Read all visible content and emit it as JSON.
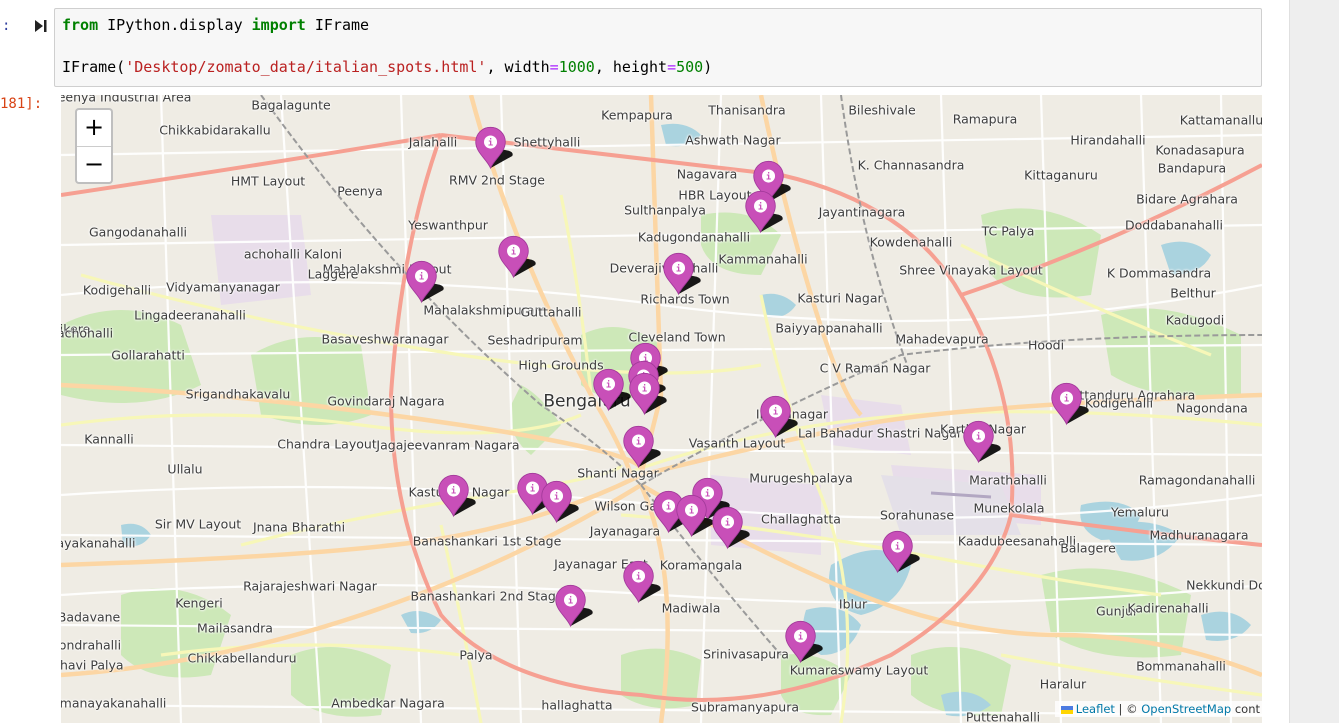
{
  "input_cell": {
    "prompt": ":",
    "line1": {
      "kw1": "from",
      "mod": " IPython.display ",
      "kw2": "import",
      "name": " IFrame"
    },
    "line2": {
      "func": "IFrame(",
      "path": "'Desktop/zomato_data/italian_spots.html'",
      "sep1": ", width",
      "eq1": "=",
      "w": "1000",
      "sep2": ", height",
      "eq2": "=",
      "h": "500",
      "close": ")"
    }
  },
  "output_cell": {
    "prompt": "181]:"
  },
  "map": {
    "zoom_in": "+",
    "zoom_out": "−",
    "attribution": {
      "leaflet": "Leaflet",
      "sep": " | © ",
      "osm": "OpenStreetMap",
      "tail": " cont"
    },
    "places": [
      {
        "name": "Bagalagunte"
      },
      {
        "name": "Chikkabidarakallu"
      },
      {
        "name": "Jalahalli"
      },
      {
        "name": "Shettyhalli"
      },
      {
        "name": "RMV 2nd Stage"
      },
      {
        "name": "Thanisandra"
      },
      {
        "name": "Kempapura"
      },
      {
        "name": "Bileshivale"
      },
      {
        "name": "Ramapura"
      },
      {
        "name": "Hirandahalli"
      },
      {
        "name": "Kattamanallur"
      },
      {
        "name": "Konadasapura"
      },
      {
        "name": "Ashwath Nagar"
      },
      {
        "name": "K. Channasandra"
      },
      {
        "name": "Bandapura"
      },
      {
        "name": "Nagavara"
      },
      {
        "name": "Kittaganuru"
      },
      {
        "name": "HMT Layout"
      },
      {
        "name": "Peenya"
      },
      {
        "name": "HBR Layout"
      },
      {
        "name": "Jayantinagara"
      },
      {
        "name": "Bidare Agrahara"
      },
      {
        "name": "Sulthanpalya"
      },
      {
        "name": "Yeswanthpur"
      },
      {
        "name": "Doddabanahalli"
      },
      {
        "name": "Gangodanahalli"
      },
      {
        "name": "Kadugondanahalli"
      },
      {
        "name": "Kowdenahalli"
      },
      {
        "name": "TC Palya"
      },
      {
        "name": "Mahalakshmi Layout"
      },
      {
        "name": "Laggere"
      },
      {
        "name": "Deverajivanahalli"
      },
      {
        "name": "Kammanahalli"
      },
      {
        "name": "Shree Vinayaka Layout"
      },
      {
        "name": "Vidyamanyanagar"
      },
      {
        "name": "K Dommasandra"
      },
      {
        "name": "Richards Town"
      },
      {
        "name": "Kasturi Nagar"
      },
      {
        "name": "Belthur"
      },
      {
        "name": "Kodigehalli"
      },
      {
        "name": "Lingadeeranahalli"
      },
      {
        "name": "Mahalakshmipuram"
      },
      {
        "name": "Guttahalli"
      },
      {
        "name": "Kadugodi"
      },
      {
        "name": "Baiyyappanahalli"
      },
      {
        "name": "Basaveshwaranagar"
      },
      {
        "name": "Seshadripuram"
      },
      {
        "name": "Cleveland Town"
      },
      {
        "name": "Mahadevapura"
      },
      {
        "name": "Hoodi"
      },
      {
        "name": "Gollarahatti"
      },
      {
        "name": "C V Raman Nagar"
      },
      {
        "name": "High Grounds"
      },
      {
        "name": "Srigandhakavalu"
      },
      {
        "name": "Govindaraj Nagara"
      },
      {
        "name": "Pattanduru Agrahara"
      },
      {
        "name": "Kodigehalli"
      },
      {
        "name": "Bengaluru"
      },
      {
        "name": "Nagondana"
      },
      {
        "name": "Indiranagar"
      },
      {
        "name": "Lal Bahadur Shastri Nagar"
      },
      {
        "name": "Karthik Nagar"
      },
      {
        "name": "Kannalli"
      },
      {
        "name": "Chandra Layout"
      },
      {
        "name": "Jagajeevanram Nagara"
      },
      {
        "name": "Vasanth Layout"
      },
      {
        "name": "Ullalu"
      },
      {
        "name": "Shanti Nagar"
      },
      {
        "name": "Murugeshpalaya"
      },
      {
        "name": "Marathahalli"
      },
      {
        "name": "Ramagondanahalli"
      },
      {
        "name": "Kasturiba Nagar"
      },
      {
        "name": "Munekolala"
      },
      {
        "name": "Wilson Garden"
      },
      {
        "name": "Yemaluru"
      },
      {
        "name": "Sorahunase"
      },
      {
        "name": "Sir MV Layout"
      },
      {
        "name": "Jnana Bharathi"
      },
      {
        "name": "Banashankari 1st Stage"
      },
      {
        "name": "Challaghatta"
      },
      {
        "name": "Madhuranagara"
      },
      {
        "name": "Jayanagara"
      },
      {
        "name": "Kaadubeesanahalli"
      },
      {
        "name": "Balagere"
      },
      {
        "name": "Jayanagar East"
      },
      {
        "name": "Koramangala"
      },
      {
        "name": "Rajarajeshwari Nagar"
      },
      {
        "name": "Banashankari 2nd Stage"
      },
      {
        "name": "Kengeri"
      },
      {
        "name": "Nekkundi Do"
      },
      {
        "name": "Madiwala"
      },
      {
        "name": "Iblur"
      },
      {
        "name": "Gunjur"
      },
      {
        "name": "Badavane"
      },
      {
        "name": "Mailasandra"
      },
      {
        "name": "Kadirenahalli"
      },
      {
        "name": "Kaikondrahalli"
      },
      {
        "name": "Chikkabellanduru"
      },
      {
        "name": "Palya"
      },
      {
        "name": "Srinivasapura"
      },
      {
        "name": "Kumaraswamy Layout"
      },
      {
        "name": "Bommanahalli"
      },
      {
        "name": "Haralur"
      },
      {
        "name": "Ramanayakanahalli"
      },
      {
        "name": "Ambedkar Nagara"
      },
      {
        "name": "hallaghatta"
      },
      {
        "name": "Subramanyapura"
      },
      {
        "name": "Puttenahalli"
      },
      {
        "name": "Garvebhavi Palya"
      },
      {
        "name": "Chikkanayakanahalli"
      },
      {
        "name": "ikere"
      },
      {
        "name": "achohalli"
      },
      {
        "name": "achohalli Kaloni"
      },
      {
        "name": "Peenya Industrial Area"
      },
      {
        "name": "nadanayakanahalli"
      }
    ],
    "marker_glyph": "i",
    "marker_color": "#c84fb8",
    "markers": [
      {
        "label": "RMV 2nd Stage marker"
      },
      {
        "label": "HBR Layout marker 1"
      },
      {
        "label": "HBR Layout marker 2"
      },
      {
        "label": "Mahalakshmipuram marker"
      },
      {
        "label": "Guttahalli marker"
      },
      {
        "label": "Richards Town marker"
      },
      {
        "label": "Bengaluru marker 1"
      },
      {
        "label": "Bengaluru marker 2"
      },
      {
        "label": "Bengaluru marker 3"
      },
      {
        "label": "Vasanth Layout marker"
      },
      {
        "label": "Indiranagar marker"
      },
      {
        "label": "Shanti Nagar marker"
      },
      {
        "label": "Marathahalli marker"
      },
      {
        "label": "Pattanduru marker"
      },
      {
        "label": "Banashankari marker"
      },
      {
        "label": "Wilson Garden marker 1"
      },
      {
        "label": "Wilson Garden marker 2"
      },
      {
        "label": "Koramangala marker 1"
      },
      {
        "label": "Koramangala marker 2"
      },
      {
        "label": "Koramangala marker 3"
      },
      {
        "label": "Koramangala marker 4"
      },
      {
        "label": "Kaadubeesanahalli marker"
      },
      {
        "label": "Madiwala marker"
      },
      {
        "label": "Jayanagar marker"
      },
      {
        "label": "Bommanahalli marker"
      }
    ]
  }
}
